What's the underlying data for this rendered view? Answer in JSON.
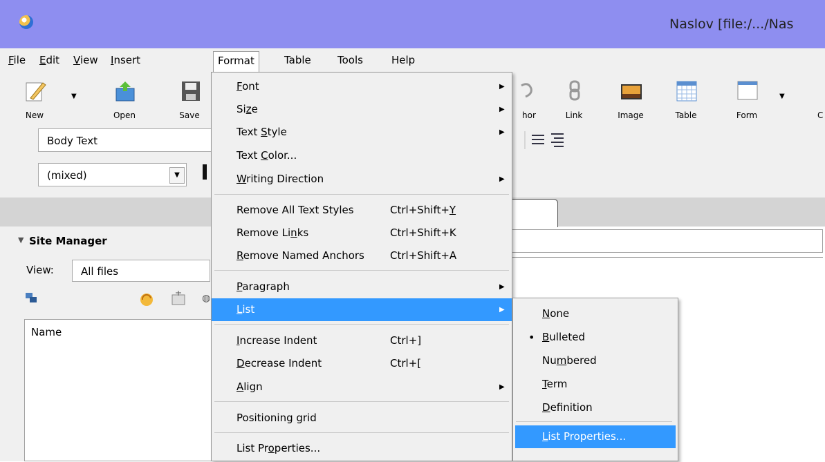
{
  "window": {
    "title": "Naslov [file:/.../Nas"
  },
  "menubar": [
    {
      "label": "File",
      "u": "F",
      "rest": "ile"
    },
    {
      "label": "Edit",
      "u": "E",
      "rest": "dit"
    },
    {
      "label": "View",
      "u": "V",
      "rest": "iew"
    },
    {
      "label": "Insert",
      "pre": "",
      "u": "I",
      "rest": "nsert"
    },
    {
      "label": "Format"
    },
    {
      "label": "Table"
    },
    {
      "label": "Tools"
    },
    {
      "label": "Help"
    }
  ],
  "toolbar": {
    "new_label": "New",
    "open_label": "Open",
    "save_label": "Save",
    "anchor_label": "hor",
    "link_label": "Link",
    "image_label": "Image",
    "table_label": "Table",
    "form_label": "Form",
    "extra_label": "C"
  },
  "format_bar": {
    "paragraph_style": "Body Text",
    "font_value": "(mixed)"
  },
  "site_manager": {
    "title": "Site Manager",
    "view_label": "View:",
    "view_value": "All files",
    "column_name": "Name"
  },
  "format_menu": {
    "items": [
      {
        "label": "Font",
        "submenu": true
      },
      {
        "label": "Size",
        "submenu": true
      },
      {
        "label": "Text Style",
        "submenu": true
      },
      {
        "label": "Text Color..."
      },
      {
        "label": "Writing Direction",
        "submenu": true
      },
      {
        "label": "Remove All Text Styles",
        "shortcut": "Ctrl+Shift+Y"
      },
      {
        "label": "Remove Links",
        "shortcut": "Ctrl+Shift+K"
      },
      {
        "label": "Remove Named Anchors",
        "shortcut": "Ctrl+Shift+A"
      },
      {
        "label": "Paragraph",
        "submenu": true
      },
      {
        "label": "List",
        "submenu": true
      },
      {
        "label": "Increase Indent",
        "shortcut": "Ctrl+]"
      },
      {
        "label": "Decrease Indent",
        "shortcut": "Ctrl+["
      },
      {
        "label": "Align",
        "submenu": true
      },
      {
        "label": "Positioning grid"
      },
      {
        "label": "List Properties..."
      }
    ]
  },
  "list_submenu": {
    "items": [
      {
        "label": "None"
      },
      {
        "label": "Bulleted",
        "checked": true
      },
      {
        "label": "Numbered"
      },
      {
        "label": "Term"
      },
      {
        "label": "Definition"
      },
      {
        "label": "List Properties..."
      }
    ]
  },
  "colors": {
    "titlebar": "#8e8ef0",
    "highlight": "#3399ff"
  }
}
